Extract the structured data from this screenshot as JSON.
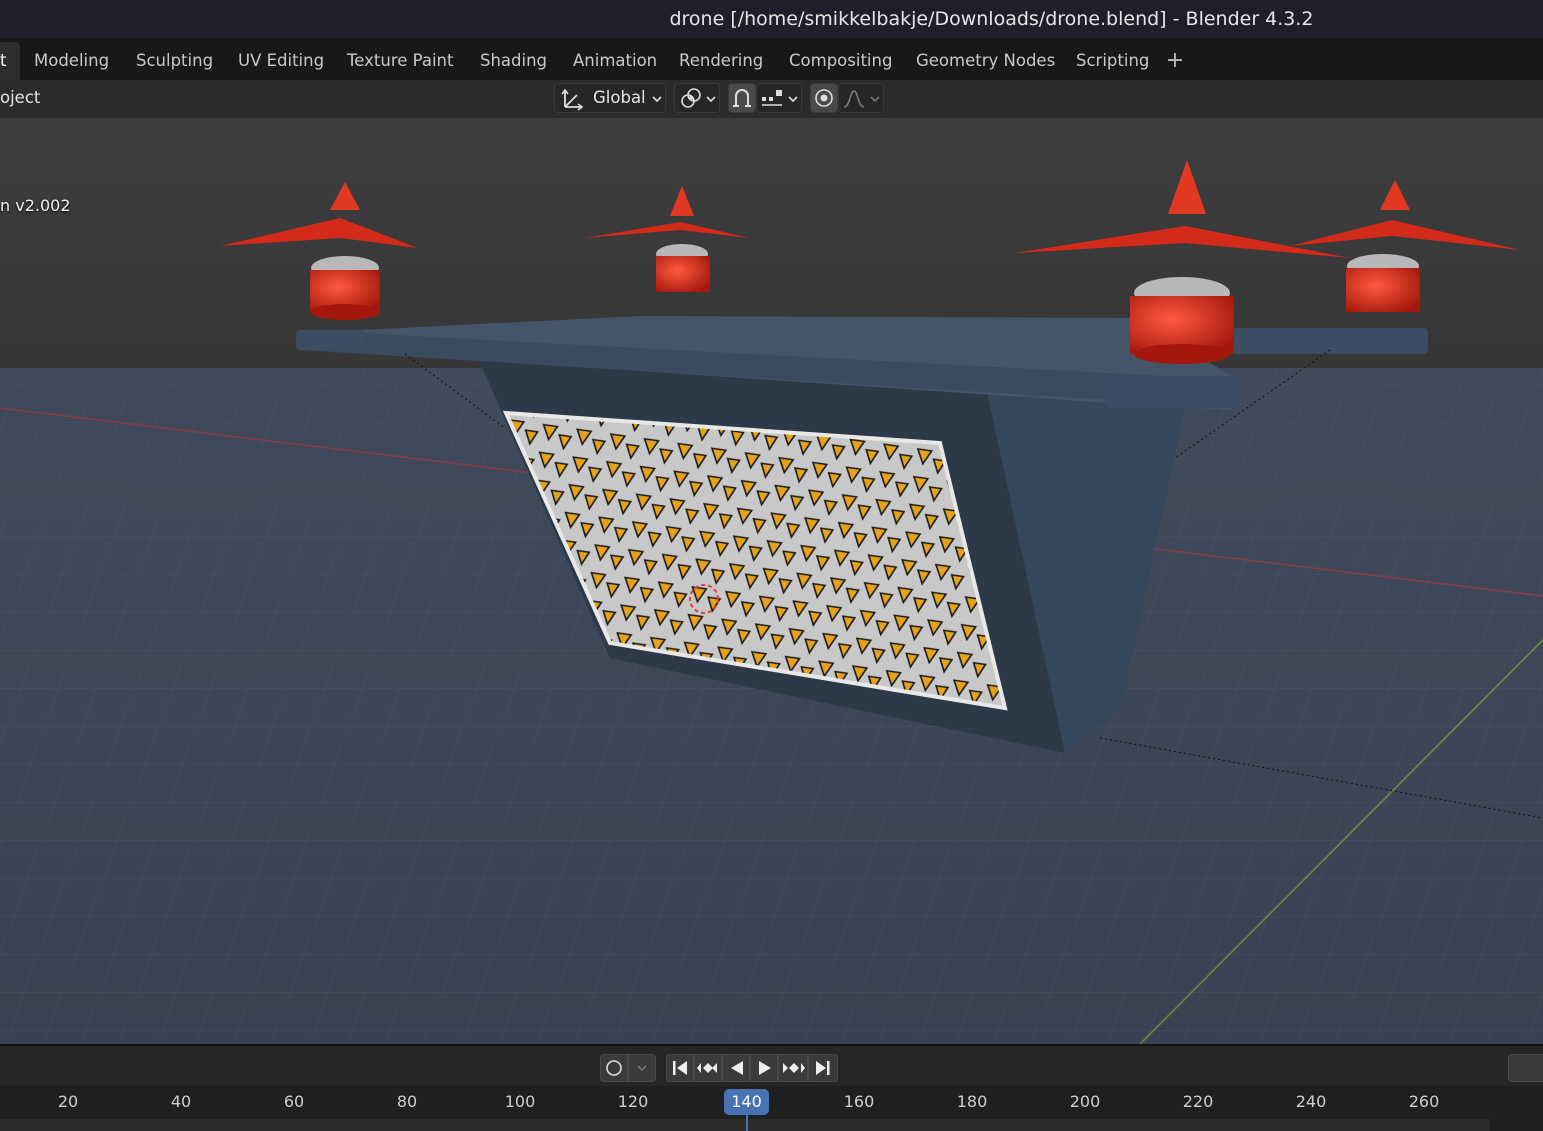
{
  "window": {
    "title": "drone [/home/smikkelbakje/Downloads/drone.blend] - Blender 4.3.2"
  },
  "workspace_tabs": [
    {
      "label": "t",
      "active": true
    },
    {
      "label": "Modeling"
    },
    {
      "label": "Sculpting"
    },
    {
      "label": "UV Editing"
    },
    {
      "label": "Texture Paint"
    },
    {
      "label": "Shading"
    },
    {
      "label": "Animation"
    },
    {
      "label": "Rendering"
    },
    {
      "label": "Compositing"
    },
    {
      "label": "Geometry Nodes"
    },
    {
      "label": "Scripting"
    }
  ],
  "header": {
    "mode_label": "oject",
    "transform_orientation": "Global",
    "icons": [
      "transform-orientation-icon",
      "pivot-icon",
      "snap-icon",
      "snap-increment-icon",
      "proportional-edit-icon",
      "falloff-icon"
    ]
  },
  "viewport": {
    "object_label": "n v2.002",
    "colors": {
      "background": "#3c4654",
      "sky": "#3a3a3a",
      "drone_body": "#2f3d4e",
      "motor_red": "#cc2a1c",
      "warning_yellow": "#e6a21a"
    }
  },
  "timeline": {
    "current_frame": "140",
    "frame_ticks": [
      "20",
      "40",
      "60",
      "80",
      "100",
      "120",
      "140",
      "160",
      "180",
      "200",
      "220",
      "240",
      "260"
    ],
    "controls": [
      "jump-start-icon",
      "prev-keyframe-icon",
      "play-reverse-icon",
      "play-icon",
      "next-keyframe-icon",
      "jump-end-icon"
    ]
  }
}
